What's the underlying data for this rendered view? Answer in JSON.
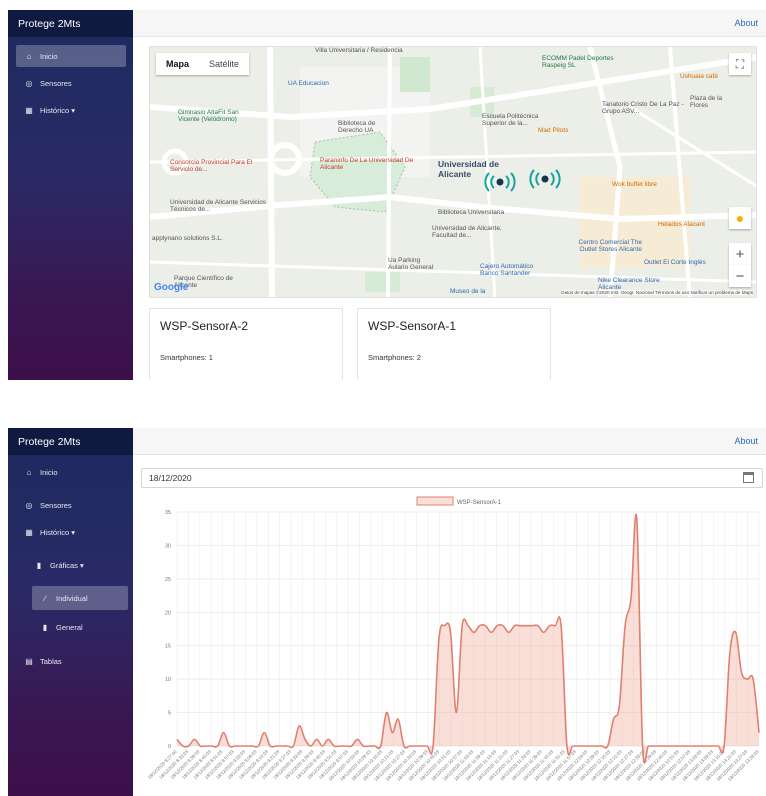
{
  "app": {
    "brand": "Protege 2Mts",
    "about": "About"
  },
  "nav": {
    "inicio": "Inicio",
    "sensores": "Sensores",
    "historico": "Histórico ▾",
    "graficas": "Gráficas ▾",
    "individual": "Individual",
    "general": "General",
    "tablas": "Tablas"
  },
  "map": {
    "tab_map": "Mapa",
    "tab_sat": "Satélite",
    "labels": {
      "l1": "Villa Universitaria / Residencia",
      "l2": "UA Educacion",
      "l3": "Gimnasio AltaFit San Vicente (Velódromo)",
      "l4": "Biblioteca de Derecho UA",
      "l5": "Consorcio Provincial Para El Servicio de...",
      "l6": "Paraninfo De La Universidad De Alicante",
      "l7": "Universidad de Alicante",
      "l8": "Universidad de Alicante Servicios Técnicos de...",
      "l9": "Biblioteca Universitaria",
      "l10": "Universidad de Alicante, Facultad de...",
      "l11": "applynano solutions S.L.",
      "l12": "Parque Científico de Alicante",
      "l13": "Ua Parking Aulario General",
      "l14": "Cajero Automático Banco Santander",
      "l15": "Museo de la",
      "l16": "ECOMM Padel Deportes Raspeig SL",
      "l17": "Ushuaia café",
      "l18": "Plaza de la Flores",
      "l19": "Tanatorio Cristo De La Paz - Grupo ASV...",
      "l20": "Escuela Politécnica Superior de la...",
      "l21": "Mad Pilots",
      "l22": "Wok buffet libre",
      "l23": "Helados Alacant",
      "l24": "Centro Comercial The Outlet Stores Alicante",
      "l25": "Outlet El Corte Inglés",
      "l26": "Nike Clearance Store Alicante"
    },
    "google": "Google",
    "attribution": "Datos de mapas ©2020 Inst. Geogr. Nacional   Términos de uso   Notificar un problema de Maps"
  },
  "cards": [
    {
      "title": "WSP-SensorA-2",
      "text": "Smartphones: 1"
    },
    {
      "title": "WSP-SensorA-1",
      "text": "Smartphones: 2"
    }
  ],
  "filter": {
    "date": "18/12/2020"
  },
  "colors": {
    "series": "#e0806f",
    "series_fill": "rgba(240,150,130,0.30)"
  },
  "chart_data": {
    "type": "line",
    "legend": "WSP-SensorA-1",
    "ylim": [
      0,
      35
    ],
    "yticks": [
      0,
      5,
      10,
      15,
      20,
      25,
      30,
      35
    ],
    "grid": true,
    "xlabels": [
      "18/12/2020 8:27:40",
      "18/12/2020 8:33:03",
      "18/12/2020 8:39:03",
      "18/12/2020 8:45:03",
      "18/12/2020 8:51:03",
      "18/12/2020 8:57:03",
      "18/12/2020 9:03:03",
      "18/12/2020 9:09:03",
      "18/12/2020 9:15:03",
      "18/12/2020 9:21:03",
      "18/12/2020 9:27:03",
      "18/12/2020 9:33:03",
      "18/12/2020 9:39:03",
      "18/12/2020 9:45:03",
      "18/12/2020 9:51:03",
      "18/12/2020 9:57:03",
      "18/12/2020 10:03:03",
      "18/12/2020 10:09:03",
      "18/12/2020 10:15:03",
      "18/12/2020 10:21:03",
      "18/12/2020 10:27:03",
      "18/12/2020 10:33:03",
      "18/12/2020 10:39:03",
      "18/12/2020 10:45:03",
      "18/12/2020 10:51:03",
      "18/12/2020 10:57:03",
      "18/12/2020 11:03:03",
      "18/12/2020 11:09:03",
      "18/12/2020 11:15:03",
      "18/12/2020 11:21:03",
      "18/12/2020 11:27:03",
      "18/12/2020 11:33:03",
      "18/12/2020 11:39:03",
      "18/12/2020 11:45:03",
      "18/12/2020 11:51:03",
      "18/12/2020 11:57:03",
      "18/12/2020 12:03:03",
      "18/12/2020 12:09:03",
      "18/12/2020 12:15:03",
      "18/12/2020 12:21:03",
      "18/12/2020 12:27:03",
      "18/12/2020 12:33:03",
      "18/12/2020 12:39:03",
      "18/12/2020 12:45:03",
      "18/12/2020 12:51:03",
      "18/12/2020 12:57:03",
      "18/12/2020 13:03:03",
      "18/12/2020 13:09:03",
      "18/12/2020 13:15:03",
      "18/12/2020 13:21:03",
      "18/12/2020 13:27:03",
      "18/12/2020 13:33:03"
    ],
    "values": [
      1,
      0,
      0,
      1,
      0,
      0,
      0,
      0,
      2,
      0,
      0,
      0,
      0,
      0,
      0,
      2,
      0,
      0,
      0,
      0,
      0,
      3,
      1,
      0,
      1,
      0,
      1,
      0,
      0,
      0,
      0,
      1,
      0,
      0,
      0,
      0,
      5,
      2,
      4,
      0,
      0,
      0,
      0,
      0,
      0,
      16,
      18,
      17,
      5,
      18,
      18,
      17,
      18,
      18,
      17,
      18,
      18,
      17,
      18,
      18,
      18,
      18,
      18,
      17,
      18,
      18,
      18,
      0,
      0,
      0,
      0,
      0,
      0,
      0,
      0,
      4,
      6,
      18,
      22,
      34,
      0,
      0,
      0,
      0,
      0,
      0,
      0,
      0,
      0,
      0,
      0,
      0,
      0,
      0,
      0,
      14,
      17,
      11,
      10,
      10,
      2
    ]
  }
}
